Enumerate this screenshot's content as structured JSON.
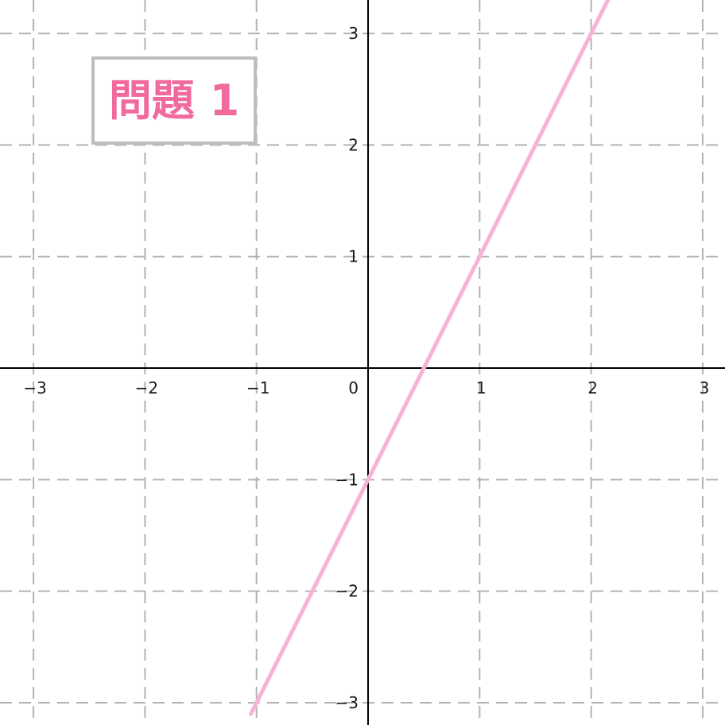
{
  "chart_data": {
    "type": "line",
    "title": "問題 1",
    "xlim": [
      -3.3,
      3.2
    ],
    "ylim": [
      -3.2,
      3.3
    ],
    "grid": true,
    "x_ticks": [
      {
        "value": -3,
        "label": "−3"
      },
      {
        "value": -2,
        "label": "−2"
      },
      {
        "value": -1,
        "label": "−1"
      },
      {
        "value": 1,
        "label": "1"
      },
      {
        "value": 2,
        "label": "2"
      },
      {
        "value": 3,
        "label": "3"
      }
    ],
    "y_ticks": [
      {
        "value": 3,
        "label": "3"
      },
      {
        "value": 2,
        "label": "2"
      },
      {
        "value": 1,
        "label": "1"
      },
      {
        "value": -1,
        "label": "−1"
      },
      {
        "value": -2,
        "label": "−2"
      },
      {
        "value": -3,
        "label": "−3"
      }
    ],
    "origin_label": "0",
    "series": [
      {
        "x": [
          -1.05,
          2.15
        ],
        "y": [
          -3.1,
          3.3
        ]
      }
    ]
  },
  "colors": {
    "series": "#f7b3d4",
    "title": "#f06a9e",
    "title_border": "#bdbdbd",
    "grid": "#b3b3b3",
    "axis": "#000000"
  }
}
